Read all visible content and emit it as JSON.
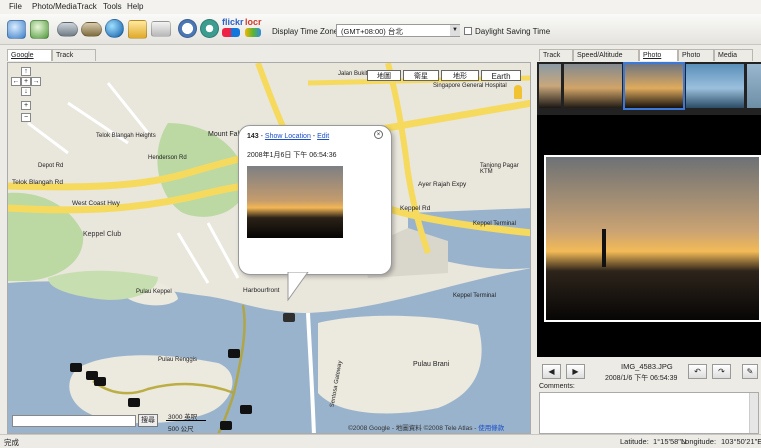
{
  "menu": [
    "File",
    "Photo/Media",
    "Track",
    "Tools",
    "Help"
  ],
  "toolbar": {
    "icons": [
      "photo-add-icon",
      "photos-add-icon",
      "track-open-icon",
      "track-save-icon",
      "globe-icon",
      "folder-icon",
      "export-icon",
      "clock-icon",
      "camera-icon",
      "flickr-logo",
      "locr-logo"
    ],
    "flickr_label": "flickr",
    "locr_label": "locr",
    "timezone_label": "Display Time Zone:",
    "timezone_value": "(GMT+08:00) 台北",
    "dst_label": "Daylight Saving Time"
  },
  "left_tabs": [
    "Google Map",
    "Track Editor"
  ],
  "right_tabs": [
    "Track List",
    "Speed/Altitude View",
    "Photo View",
    "Photo List",
    "Media List"
  ],
  "map": {
    "types": [
      "地圖",
      "衛星",
      "地形",
      "Earth"
    ],
    "search_button": "搜尋",
    "scale_imperial": "3000 英呎",
    "scale_metric": "500 公尺",
    "copyright": "©2008 Google - 地圖資料 ©2008 Tele Atlas -",
    "copyright_link": "使用條款",
    "labels": [
      "Mount Faber Park",
      "Keppel Club",
      "Telok Blangah Rd",
      "West Coast Hwy",
      "Pulau Brani",
      "Harbourfront",
      "Ayer Rajah Expy",
      "Keppel Rd",
      "Singapore General Hospital",
      "Tanjong Pagar KTM",
      "Keppel Terminal",
      "Pulau Keppel",
      "Pulau Renggis",
      "Henderson Rd",
      "Telok Blangah Heights",
      "Depot Rd",
      "Jalan Bukit Merah",
      "Keppel Terminal",
      "Sentosa Gateway"
    ],
    "popup": {
      "id": "143",
      "sep": " - ",
      "show_location": "Show Location",
      "edit": "Edit",
      "datetime": "2008年1月6日 下午 06:54:36"
    }
  },
  "photo": {
    "filename": "IMG_4583.JPG",
    "datetime": "2008/1/6 下午 06:54:39",
    "comments_label": "Comments:"
  },
  "status": {
    "left": "完成",
    "lat_label": "Latitude:",
    "lat": "1°15'58\"N",
    "lon_label": "Longitude:",
    "lon": "103°50'21\"E"
  }
}
